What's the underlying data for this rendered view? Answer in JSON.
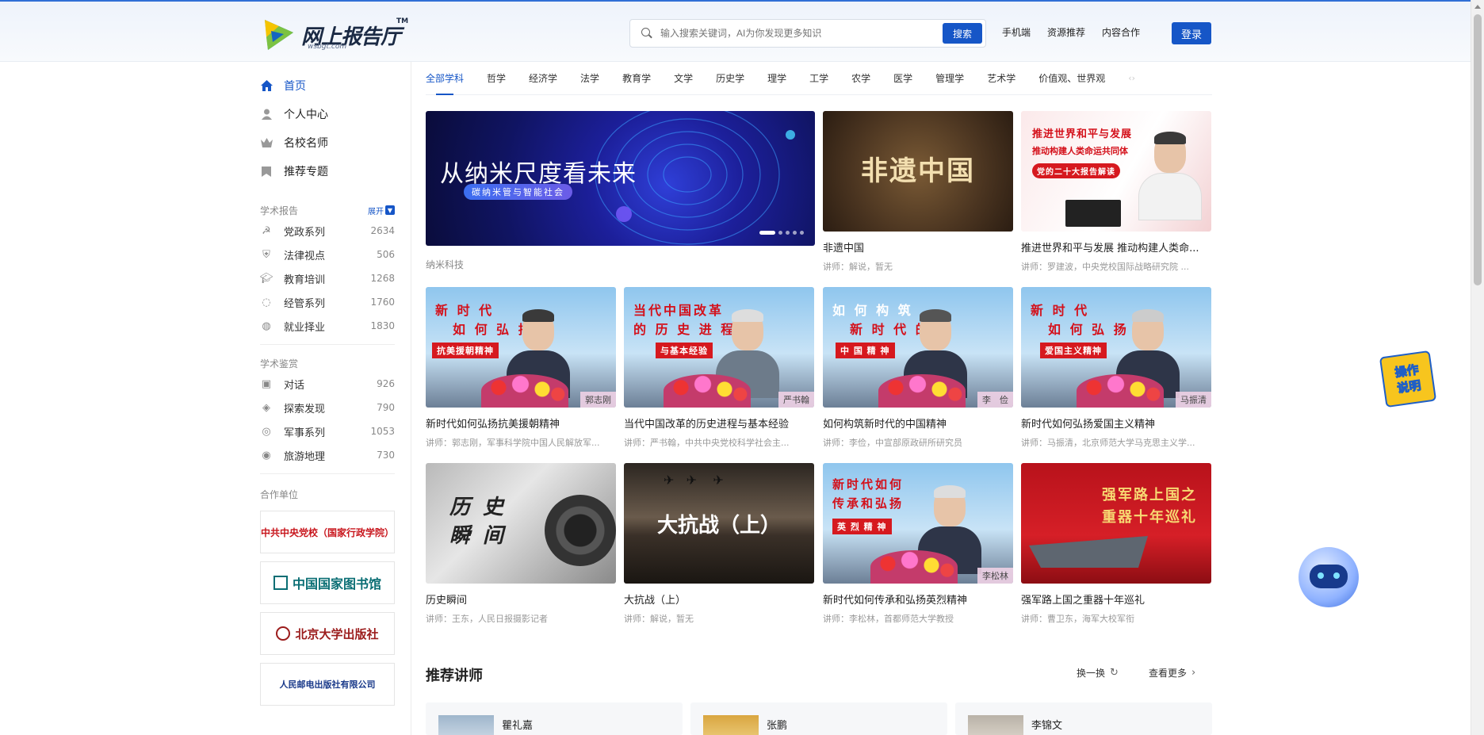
{
  "header": {
    "logo_text": "网上报告厅",
    "logo_sub": "wsbgt.com",
    "logo_tm": "TM",
    "search_placeholder": "输入搜索关键词，AI为你发现更多知识",
    "search_button": "搜索",
    "links": [
      "手机端",
      "资源推荐",
      "内容合作"
    ],
    "login": "登录"
  },
  "sidebar": {
    "main": [
      {
        "label": "首页",
        "icon": "home-icon"
      },
      {
        "label": "个人中心",
        "icon": "user-icon"
      },
      {
        "label": "名校名师",
        "icon": "crown-icon"
      },
      {
        "label": "推荐专题",
        "icon": "bookmark-icon"
      }
    ],
    "section1": {
      "title": "学术报告",
      "expand": "展开",
      "items": [
        {
          "label": "党政系列",
          "count": "2634"
        },
        {
          "label": "法律视点",
          "count": "506"
        },
        {
          "label": "教育培训",
          "count": "1268"
        },
        {
          "label": "经管系列",
          "count": "1760"
        },
        {
          "label": "就业择业",
          "count": "1830"
        }
      ]
    },
    "section2": {
      "title": "学术鉴赏",
      "items": [
        {
          "label": "对话",
          "count": "926"
        },
        {
          "label": "探索发现",
          "count": "790"
        },
        {
          "label": "军事系列",
          "count": "1053"
        },
        {
          "label": "旅游地理",
          "count": "730"
        }
      ]
    },
    "partners_title": "合作单位",
    "partners": [
      "中共中央党校（国家行政学院）",
      "中国国家图书馆",
      "北京大学出版社",
      "人民邮电出版社有限公司"
    ]
  },
  "tabs": [
    "全部学科",
    "哲学",
    "经济学",
    "法学",
    "教育学",
    "文学",
    "历史学",
    "理学",
    "工学",
    "农学",
    "医学",
    "管理学",
    "艺术学",
    "价值观、世界观"
  ],
  "banner": {
    "title": "从纳米尺度看未来",
    "sub": "碳纳米管与智能社会",
    "caption": "纳米科技"
  },
  "cards": [
    {
      "title": "非遗中国",
      "sub": "讲师：解说，暂无",
      "thumb_text": "非遗中国"
    },
    {
      "title": "推进世界和平与发展 推动构建人类命...",
      "sub": "讲师：罗建波，中央党校国际战略研究院 ...",
      "thumb_lines": [
        "推进世界和平与发展",
        "推动构建人类命运共同体"
      ],
      "thumb_tag": "党的二十大报告解读"
    },
    {
      "title": "新时代如何弘扬抗美援朝精神",
      "sub": "讲师：郭志刚，军事科学院中国人民解放军...",
      "thumb_lines": [
        "新 时 代",
        "如 何 弘 扬"
      ],
      "thumb_tag": "抗美援朝精神",
      "name": "郭志刚"
    },
    {
      "title": "当代中国改革的历史进程与基本经验",
      "sub": "讲师：严书翰，中共中央党校科学社会主...",
      "thumb_lines": [
        "当代中国改革",
        "的 历 史 进 程"
      ],
      "thumb_tag": "与基本经验",
      "name": "严书翰"
    },
    {
      "title": "如何构筑新时代的中国精神",
      "sub": "讲师：李俭，中宣部原政研所研究员",
      "thumb_lines": [
        "如 何 构 筑",
        "新 时 代 的"
      ],
      "thumb_tag": "中 国 精 神",
      "name": "李　俭"
    },
    {
      "title": "新时代如何弘扬爱国主义精神",
      "sub": "讲师：马振清，北京师范大学马克思主义学...",
      "thumb_lines": [
        "新 时 代",
        "如 何 弘 扬"
      ],
      "thumb_tag": "爱国主义精神",
      "name": "马振清"
    },
    {
      "title": "历史瞬间",
      "sub": "讲师：王东，人民日报摄影记者",
      "thumb_text": "历史瞬间"
    },
    {
      "title": "大抗战（上）",
      "sub": "讲师：解说，暂无",
      "thumb_text": "大抗战（上）"
    },
    {
      "title": "新时代如何传承和弘扬英烈精神",
      "sub": "讲师：李松林，首都师范大学教授",
      "thumb_lines": [
        "新时代如何",
        "传承和弘扬"
      ],
      "thumb_tag": "英 烈 精 神",
      "name": "李松林"
    },
    {
      "title": "强军路上国之重器十年巡礼",
      "sub": "讲师：曹卫东，海军大校军衔",
      "thumb_lines": [
        "强军路上国之",
        "重器十年巡礼"
      ]
    }
  ],
  "recommend": {
    "title": "推荐讲师",
    "refresh": "换一换",
    "more": "查看更多",
    "lecturers": [
      "瞿礼嘉",
      "张鹏",
      "李锦文"
    ]
  },
  "float": {
    "guide": "操作说明"
  }
}
